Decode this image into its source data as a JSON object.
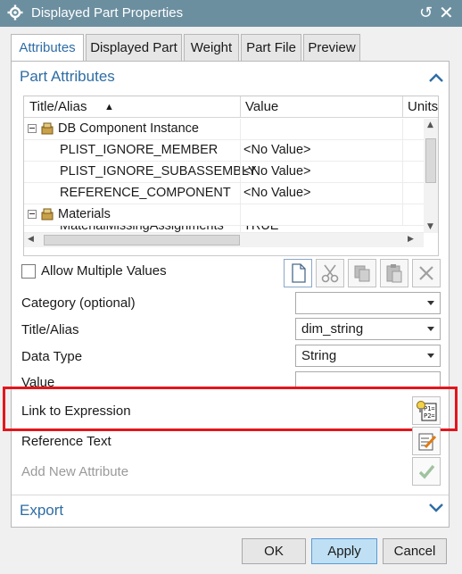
{
  "window": {
    "title": "Displayed Part Properties",
    "reset_icon": "reset-icon",
    "close_icon": "close-icon"
  },
  "tabs": [
    {
      "label": "Attributes",
      "active": true
    },
    {
      "label": "Displayed Part",
      "active": false
    },
    {
      "label": "Weight",
      "active": false
    },
    {
      "label": "Part File",
      "active": false
    },
    {
      "label": "Preview",
      "active": false
    }
  ],
  "part_attributes": {
    "section_title": "Part Attributes",
    "columns": [
      "Title/Alias",
      "Value",
      "Units"
    ],
    "sort_indicator": "▲",
    "rows": [
      {
        "title": "DB Component Instance",
        "value": "",
        "type": "group"
      },
      {
        "title": "PLIST_IGNORE_MEMBER",
        "value": "<No Value>",
        "type": "item"
      },
      {
        "title": "PLIST_IGNORE_SUBASSEMBLY",
        "value": "<No Value>",
        "type": "item"
      },
      {
        "title": "REFERENCE_COMPONENT",
        "value": "<No Value>",
        "type": "item"
      },
      {
        "title": "Materials",
        "value": "",
        "type": "group"
      },
      {
        "title": "MaterialMissingAssignments",
        "value": "TRUE",
        "type": "item"
      }
    ]
  },
  "allow_multiple": {
    "label": "Allow Multiple Values",
    "checked": false
  },
  "form": {
    "category": {
      "label": "Category (optional)",
      "value": ""
    },
    "title_alias": {
      "label": "Title/Alias",
      "value": "dim_string"
    },
    "data_type": {
      "label": "Data Type",
      "value": "String"
    },
    "value": {
      "label": "Value",
      "value": ""
    },
    "link_expression": {
      "label": "Link to Expression"
    },
    "reference_text": {
      "label": "Reference Text"
    },
    "add_new": {
      "label": "Add New Attribute"
    }
  },
  "export": {
    "section_title": "Export"
  },
  "buttons": {
    "ok": "OK",
    "apply": "Apply",
    "cancel": "Cancel"
  },
  "colors": {
    "titlebar": "#6c8fa0",
    "accent": "#2e6da4",
    "highlight": "#e2161c"
  }
}
